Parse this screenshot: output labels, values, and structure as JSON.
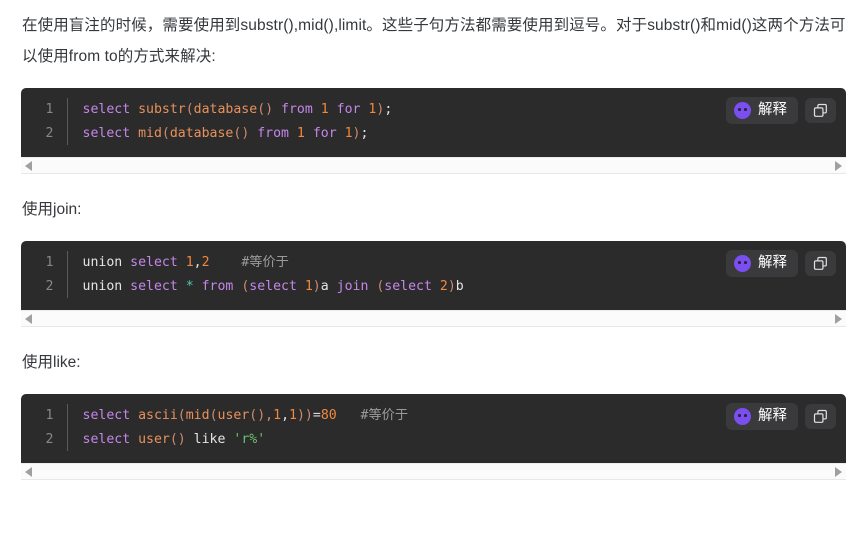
{
  "document": {
    "intro_paragraph": "在使用盲注的时候，需要使用到substr(),mid(),limit。这些子句方法都需要使用到逗号。对于substr()和mid()这两个方法可以使用from to的方式来解决:",
    "headings": {
      "join": "使用join:",
      "like": "使用like:"
    }
  },
  "code_toolbar": {
    "explain_label": "解释",
    "explain_icon": "ai-assistant-avatar-icon",
    "copy_icon": "copy-icon",
    "accent_color": "#7b4ef0",
    "button_bg": "#3a3a3c"
  },
  "code_blocks": [
    {
      "id": "block-substr-mid",
      "background": "#2b2b2b",
      "lines": [
        {
          "number": "1",
          "tokens": [
            {
              "text": "select ",
              "type": "keyword"
            },
            {
              "text": "substr",
              "type": "function"
            },
            {
              "text": "(",
              "type": "paren"
            },
            {
              "text": "database",
              "type": "function"
            },
            {
              "text": "() ",
              "type": "paren"
            },
            {
              "text": "from ",
              "type": "keyword"
            },
            {
              "text": "1",
              "type": "number"
            },
            {
              "text": " ",
              "type": "plain"
            },
            {
              "text": "for ",
              "type": "keyword"
            },
            {
              "text": "1",
              "type": "number"
            },
            {
              "text": ")",
              "type": "paren"
            },
            {
              "text": ";",
              "type": "plain"
            }
          ]
        },
        {
          "number": "2",
          "tokens": [
            {
              "text": "select ",
              "type": "keyword"
            },
            {
              "text": "mid",
              "type": "function"
            },
            {
              "text": "(",
              "type": "paren"
            },
            {
              "text": "database",
              "type": "function"
            },
            {
              "text": "() ",
              "type": "paren"
            },
            {
              "text": "from ",
              "type": "keyword"
            },
            {
              "text": "1",
              "type": "number"
            },
            {
              "text": " ",
              "type": "plain"
            },
            {
              "text": "for ",
              "type": "keyword"
            },
            {
              "text": "1",
              "type": "number"
            },
            {
              "text": ")",
              "type": "paren"
            },
            {
              "text": ";",
              "type": "plain"
            }
          ]
        }
      ]
    },
    {
      "id": "block-join",
      "background": "#2b2b2b",
      "lines": [
        {
          "number": "1",
          "tokens": [
            {
              "text": "union ",
              "type": "plain"
            },
            {
              "text": "select ",
              "type": "keyword"
            },
            {
              "text": "1",
              "type": "number"
            },
            {
              "text": ",",
              "type": "plain"
            },
            {
              "text": "2",
              "type": "number"
            },
            {
              "text": "    ",
              "type": "plain"
            },
            {
              "text": "#等价于",
              "type": "comment"
            }
          ]
        },
        {
          "number": "2",
          "tokens": [
            {
              "text": "union ",
              "type": "plain"
            },
            {
              "text": "select ",
              "type": "keyword"
            },
            {
              "text": "* ",
              "type": "star"
            },
            {
              "text": "from ",
              "type": "keyword"
            },
            {
              "text": "(",
              "type": "paren"
            },
            {
              "text": "select ",
              "type": "keyword"
            },
            {
              "text": "1",
              "type": "number"
            },
            {
              "text": ")",
              "type": "paren"
            },
            {
              "text": "a ",
              "type": "plain"
            },
            {
              "text": "join ",
              "type": "keyword"
            },
            {
              "text": "(",
              "type": "paren"
            },
            {
              "text": "select ",
              "type": "keyword"
            },
            {
              "text": "2",
              "type": "number"
            },
            {
              "text": ")",
              "type": "paren"
            },
            {
              "text": "b",
              "type": "plain"
            }
          ]
        }
      ]
    },
    {
      "id": "block-like",
      "background": "#2b2b2b",
      "lines": [
        {
          "number": "1",
          "tokens": [
            {
              "text": "select ",
              "type": "keyword"
            },
            {
              "text": "ascii",
              "type": "function"
            },
            {
              "text": "(",
              "type": "paren"
            },
            {
              "text": "mid",
              "type": "function"
            },
            {
              "text": "(",
              "type": "paren"
            },
            {
              "text": "user",
              "type": "function"
            },
            {
              "text": "(),",
              "type": "paren"
            },
            {
              "text": "1",
              "type": "number"
            },
            {
              "text": ",",
              "type": "plain"
            },
            {
              "text": "1",
              "type": "number"
            },
            {
              "text": "))",
              "type": "paren"
            },
            {
              "text": "=",
              "type": "operator"
            },
            {
              "text": "80",
              "type": "number"
            },
            {
              "text": "   ",
              "type": "plain"
            },
            {
              "text": "#等价于",
              "type": "comment"
            }
          ]
        },
        {
          "number": "2",
          "tokens": [
            {
              "text": "select ",
              "type": "keyword"
            },
            {
              "text": "user",
              "type": "function"
            },
            {
              "text": "() ",
              "type": "paren"
            },
            {
              "text": "like ",
              "type": "plain"
            },
            {
              "text": "'r%'",
              "type": "string"
            }
          ]
        }
      ]
    }
  ],
  "scrollbars": {
    "left_arrow_icon": "triangle-left-icon",
    "right_arrow_icon": "triangle-right-icon"
  }
}
